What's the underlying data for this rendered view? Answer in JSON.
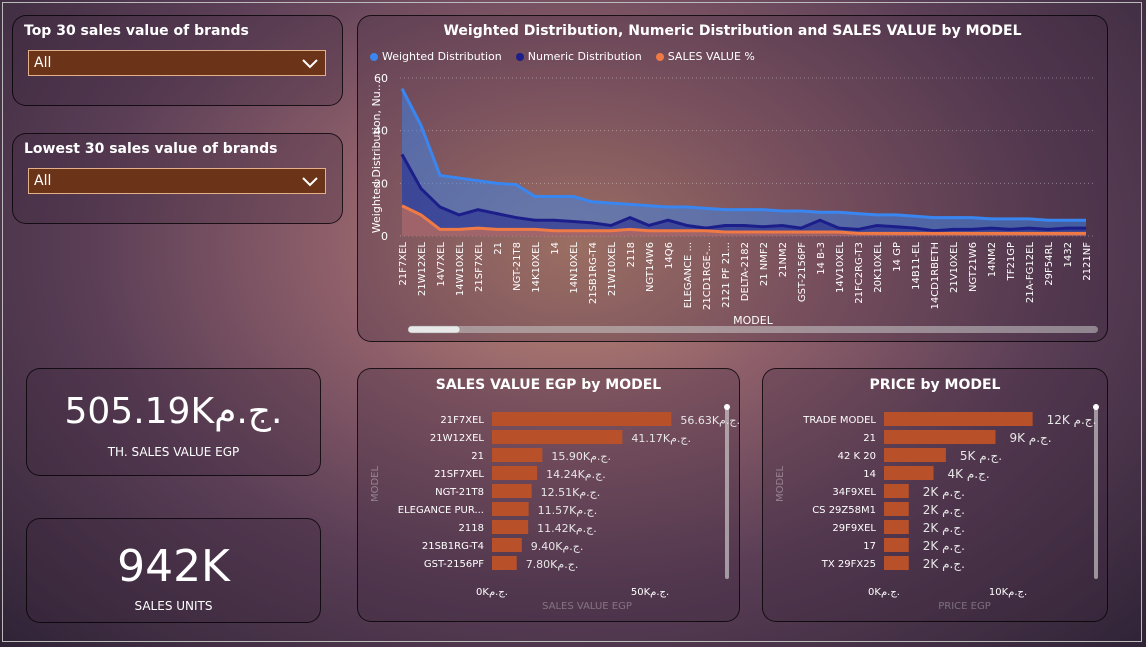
{
  "slicers": [
    {
      "title": "Top 30 sales value of brands",
      "value": "All"
    },
    {
      "title": "Lowest 30 sales value of brands",
      "value": "All"
    }
  ],
  "kpis": [
    {
      "value": "505.19Kج.م.",
      "label": "TH. SALES VALUE EGP"
    },
    {
      "value": "942K",
      "label": "SALES UNITS"
    }
  ],
  "colors": {
    "weighted": "#3a86f0",
    "numeric": "#1c1f8a",
    "sales": "#f07a45",
    "bar": "#b8512a",
    "dropdown_bg": "#6b3419",
    "dropdown_border": "#e3b089"
  },
  "chart_data": [
    {
      "type": "area",
      "title": "Weighted Distribution, Numeric Distribution and SALES VALUE by MODEL",
      "xlabel": "MODEL",
      "ylabel": "Weighted Distribution, Nu...",
      "ylim": [
        0,
        60
      ],
      "yticks": [
        0,
        20,
        40,
        60
      ],
      "legend_position": "top-left",
      "grid": true,
      "categories": [
        "21F7XEL",
        "21W12XEL",
        "14V7XEL",
        "14W10XEL",
        "21SF7XEL",
        "21",
        "NGT-21T8",
        "14K10XEL",
        "14",
        "14N10XEL",
        "21SB1RG-T4",
        "21W10XEL",
        "2118",
        "NGT14W6",
        "14Q6",
        "ELEGANCE ...",
        "21CD1RGE-...",
        "2121 PF 21...",
        "DELTA-2182",
        "21 NMF2",
        "21NM2",
        "GST-2156PF",
        "14 B-3",
        "14V10XEL",
        "21FC2RG-T3",
        "20K10XEL",
        "14 GP",
        "14B11-EL",
        "14CD1RBETH",
        "21V10XEL",
        "NGT21W6",
        "14NM2",
        "TF21GP",
        "21A-FG12EL",
        "29F54RL",
        "1432",
        "2121NF"
      ],
      "series": [
        {
          "name": "Weighted Distribution",
          "values": [
            56,
            42,
            23,
            22,
            21,
            20,
            19.5,
            15,
            15,
            15,
            13,
            12.5,
            12,
            11.5,
            11,
            11,
            10.5,
            10,
            10,
            10,
            9.5,
            9.5,
            9,
            9,
            8.5,
            8,
            8,
            7.5,
            7,
            7,
            7,
            6.5,
            6.5,
            6.5,
            6,
            6,
            6
          ]
        },
        {
          "name": "Numeric Distribution",
          "values": [
            31,
            18,
            11,
            8,
            10,
            8.5,
            7,
            6,
            6,
            5.5,
            5,
            4,
            7,
            4,
            6,
            4,
            3,
            4,
            4,
            3.5,
            4,
            3,
            6,
            3,
            2.5,
            4,
            3.5,
            3,
            2,
            2.5,
            2.5,
            3,
            2.5,
            3,
            2.5,
            3,
            3
          ]
        },
        {
          "name": "SALES VALUE %",
          "values": [
            11.5,
            8,
            2.5,
            2.5,
            3,
            2.5,
            2.5,
            2.5,
            2,
            2,
            2,
            2,
            2.5,
            2,
            2,
            2,
            2,
            1.5,
            1.5,
            1.5,
            1.5,
            1.5,
            1.5,
            1.5,
            1,
            1,
            1,
            1,
            1,
            1,
            1,
            1,
            1,
            1,
            1,
            1,
            1
          ]
        }
      ]
    },
    {
      "type": "bar",
      "orientation": "horizontal",
      "title": "SALES VALUE EGP by MODEL",
      "ylabel": "MODEL",
      "xlabel": "SALES VALUE EGP",
      "xlim": [
        0,
        60000
      ],
      "xticks": [
        "0Kج.م.",
        "50Kج.م."
      ],
      "categories": [
        "21F7XEL",
        "21W12XEL",
        "21",
        "21SF7XEL",
        "NGT-21T8",
        "ELEGANCE PUR...",
        "2118",
        "21SB1RG-T4",
        "GST-2156PF"
      ],
      "values": [
        56630,
        41170,
        15900,
        14240,
        12510,
        11570,
        11420,
        9400,
        7800
      ],
      "labels": [
        "56.63Kج.م.",
        "41.17Kج.م.",
        "15.90Kج.م.",
        "14.24Kج.م.",
        "12.51Kج.م.",
        "11.57Kج.م.",
        "11.42Kج.م.",
        "9.40Kج.م.",
        "7.80Kج.م."
      ]
    },
    {
      "type": "bar",
      "orientation": "horizontal",
      "title": "PRICE by MODEL",
      "ylabel": "MODEL",
      "xlabel": "PRICE EGP",
      "xlim": [
        0,
        13000
      ],
      "xticks": [
        "0Kج.م.",
        "10Kج.م."
      ],
      "categories": [
        "TRADE MODEL",
        "21",
        "42 K 20",
        "14",
        "34F9XEL",
        "CS 29Z58M1",
        "29F9XEL",
        "17",
        "TX 29FX25"
      ],
      "values": [
        12000,
        9000,
        5000,
        4000,
        2000,
        2000,
        2000,
        2000,
        2000
      ],
      "labels": [
        "12K ج.م.",
        "9K ج.م.",
        "5K ج.م.",
        "4K ج.م.",
        "2K ج.م.",
        "2K ج.م.",
        "2K ج.م.",
        "2K ج.م.",
        "2K ج.م."
      ]
    }
  ]
}
